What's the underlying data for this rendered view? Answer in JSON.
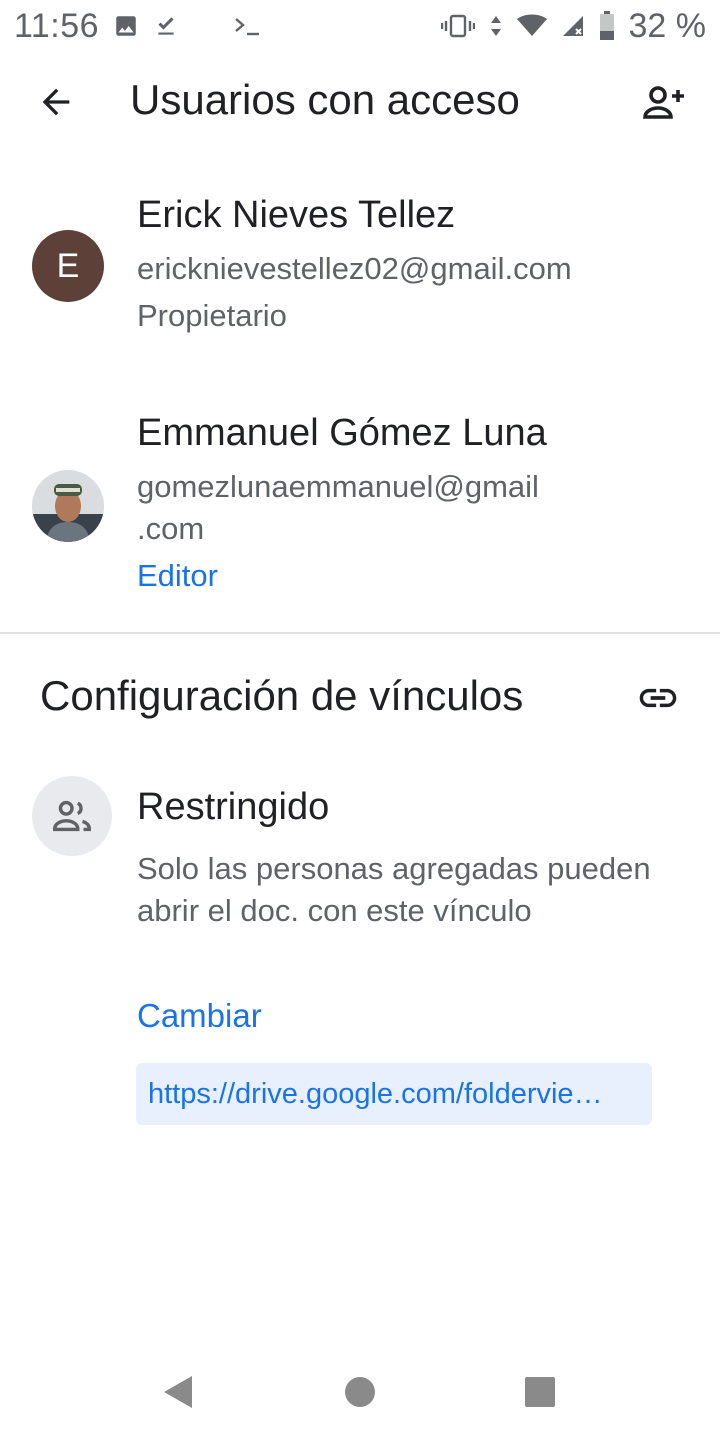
{
  "status_bar": {
    "time": "11:56",
    "battery_percent": "32 %",
    "icons": [
      "image-icon",
      "download-done-icon",
      "terminal-icon",
      "vibrate-icon",
      "data-arrows-icon",
      "wifi-icon",
      "signal-icon",
      "battery-icon"
    ]
  },
  "toolbar": {
    "title": "Usuarios con acceso",
    "back_icon": "arrow-back-icon",
    "add_icon": "person-add-icon"
  },
  "people": [
    {
      "avatar_letter": "E",
      "avatar_color": "#5d4037",
      "name": "Erick Nieves Tellez",
      "email": "ericknievestellez02@gmail.com",
      "role": "Propietario"
    },
    {
      "avatar_type": "photo",
      "name": "Emmanuel Gómez Luna",
      "email": "gomezlunaemmanuel@gmail\n.com",
      "role": "Editor"
    }
  ],
  "link_settings": {
    "title": "Configuración de vínculos",
    "access_title": "Restringido",
    "access_description": "Solo las personas agregadas pueden abrir el doc. con este vínculo",
    "change_label": "Cambiar",
    "url": "https://drive.google.com/foldervie…"
  },
  "colors": {
    "accent": "#1a73e8",
    "url_chip_bg": "#e8f0fe",
    "text_primary": "#202124",
    "text_secondary": "#5f6368"
  }
}
